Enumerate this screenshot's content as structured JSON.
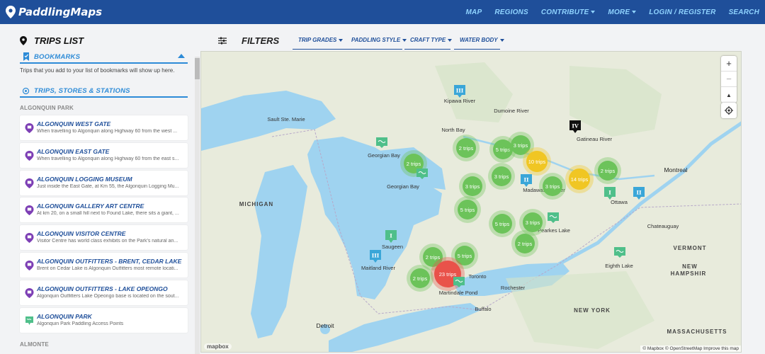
{
  "brand": {
    "name": "PaddlingMaps"
  },
  "nav": {
    "items": [
      "MAP",
      "REGIONS",
      "CONTRIBUTE",
      "MORE",
      "LOGIN / REGISTER",
      "SEARCH"
    ]
  },
  "sidebar": {
    "title": "TRIPS LIST",
    "bookmarks_title": "BOOKMARKS",
    "bookmarks_text": "Trips that you add to your list of bookmarks will show up here.",
    "stations_title": "TRIPS, STORES & STATIONS",
    "region1": "ALGONQUIN PARK",
    "region2": "ALMONTE",
    "cards": [
      {
        "title": "ALGONQUIN WEST GATE",
        "desc": "When travelling to Algonquin along Highway 60 from the west ..."
      },
      {
        "title": "ALGONQUIN EAST GATE",
        "desc": "When travelling to Algonquin along Highway 60 from the east s..."
      },
      {
        "title": "ALGONQUIN LOGGING MUSEUM",
        "desc": "Just inside the East Gate, at Km 55, the Algonquin Logging Mu..."
      },
      {
        "title": "ALGONQUIN GALLERY ART CENTRE",
        "desc": "At km 20, on a small hill next to Found Lake, there sits a giant, ..."
      },
      {
        "title": "ALGONQUIN VISITOR CENTRE",
        "desc": "Visitor Centre has world class exhibits on the Park's natural an..."
      },
      {
        "title": "ALGONQUIN OUTFITTERS - BRENT, CEDAR LAKE",
        "desc": "Brent on Cedar Lake is Algonquin Outfitters most remote locati..."
      },
      {
        "title": "ALGONQUIN OUTFITTERS - LAKE OPEONGO",
        "desc": "Algonquin Outfitters Lake Opeongo base is located on the sout..."
      },
      {
        "title": "ALGONQUIN PARK",
        "desc": "Algonquin Park Paddling Access Points"
      }
    ]
  },
  "filters": {
    "label": "FILTERS",
    "buttons": [
      "TRIP GRADES",
      "PADDLING STYLE",
      "CRAFT TYPE",
      "WATER BODY"
    ]
  },
  "map": {
    "attribution": "© Mapbox © OpenStreetMap  Improve this map",
    "logo": "mapbox",
    "zoom_in": "+",
    "zoom_out": "−",
    "compass": "▲",
    "labels": [
      {
        "t": "Kipawa River",
        "s": "city"
      },
      {
        "t": "Dumoine River",
        "s": "city"
      },
      {
        "t": "Gatineau River",
        "s": "city"
      },
      {
        "t": "Sault Ste. Marie",
        "s": "city"
      },
      {
        "t": "North Bay",
        "s": "city"
      },
      {
        "t": "Georgian Bay",
        "s": "city"
      },
      {
        "t": "Georgian Bay",
        "s": "city"
      },
      {
        "t": "Madawaska River",
        "s": "city"
      },
      {
        "t": "Montreal",
        "s": "bigcity"
      },
      {
        "t": "Chateauguay",
        "s": "city"
      },
      {
        "t": "MICHIGAN",
        "s": "state"
      },
      {
        "t": "Pearkes Lake",
        "s": "city"
      },
      {
        "t": "Saugeen",
        "s": "city"
      },
      {
        "t": "Maitland River",
        "s": "city"
      },
      {
        "t": "Martindale Pond",
        "s": "city"
      },
      {
        "t": "Eighth Lake",
        "s": "city"
      },
      {
        "t": "VERMONT",
        "s": "state"
      },
      {
        "t": "NEW",
        "s": "state"
      },
      {
        "t": "HAMPSHIR",
        "s": "state"
      },
      {
        "t": "NEW YORK",
        "s": "state"
      },
      {
        "t": "MASSACHUSETTS",
        "s": "state"
      },
      {
        "t": "Detroit",
        "s": "bigcity"
      },
      {
        "t": "Toronto",
        "s": "city"
      },
      {
        "t": "Buffalo",
        "s": "city"
      },
      {
        "t": "Rochester",
        "s": "city"
      },
      {
        "t": "Ottawa",
        "s": "city"
      }
    ],
    "clusters": [
      {
        "t": "2 trips",
        "c": "green"
      },
      {
        "t": "2 trips",
        "c": "green"
      },
      {
        "t": "5 trips",
        "c": "green"
      },
      {
        "t": "3 trips",
        "c": "green"
      },
      {
        "t": "10 trips",
        "c": "yellow"
      },
      {
        "t": "3 trips",
        "c": "green"
      },
      {
        "t": "14 trips",
        "c": "yellow"
      },
      {
        "t": "3 trips",
        "c": "green"
      },
      {
        "t": "3 trips",
        "c": "green"
      },
      {
        "t": "2 trips",
        "c": "green"
      },
      {
        "t": "5 trips",
        "c": "green"
      },
      {
        "t": "5 trips",
        "c": "green"
      },
      {
        "t": "3 trips",
        "c": "green"
      },
      {
        "t": "2 trips",
        "c": "green"
      },
      {
        "t": "2 trips",
        "c": "green"
      },
      {
        "t": "5 trips",
        "c": "green"
      },
      {
        "t": "23 trips",
        "c": "red"
      },
      {
        "t": "2 trips",
        "c": "green"
      }
    ],
    "grade_markers": [
      "III",
      "IV",
      "II",
      "III",
      "II",
      "I",
      "I"
    ]
  },
  "colors": {
    "topbar": "#1f4f9a",
    "accent": "#2d8bd7",
    "green": "#6cc35a",
    "yellow": "#f0c623",
    "red": "#e9524a"
  }
}
